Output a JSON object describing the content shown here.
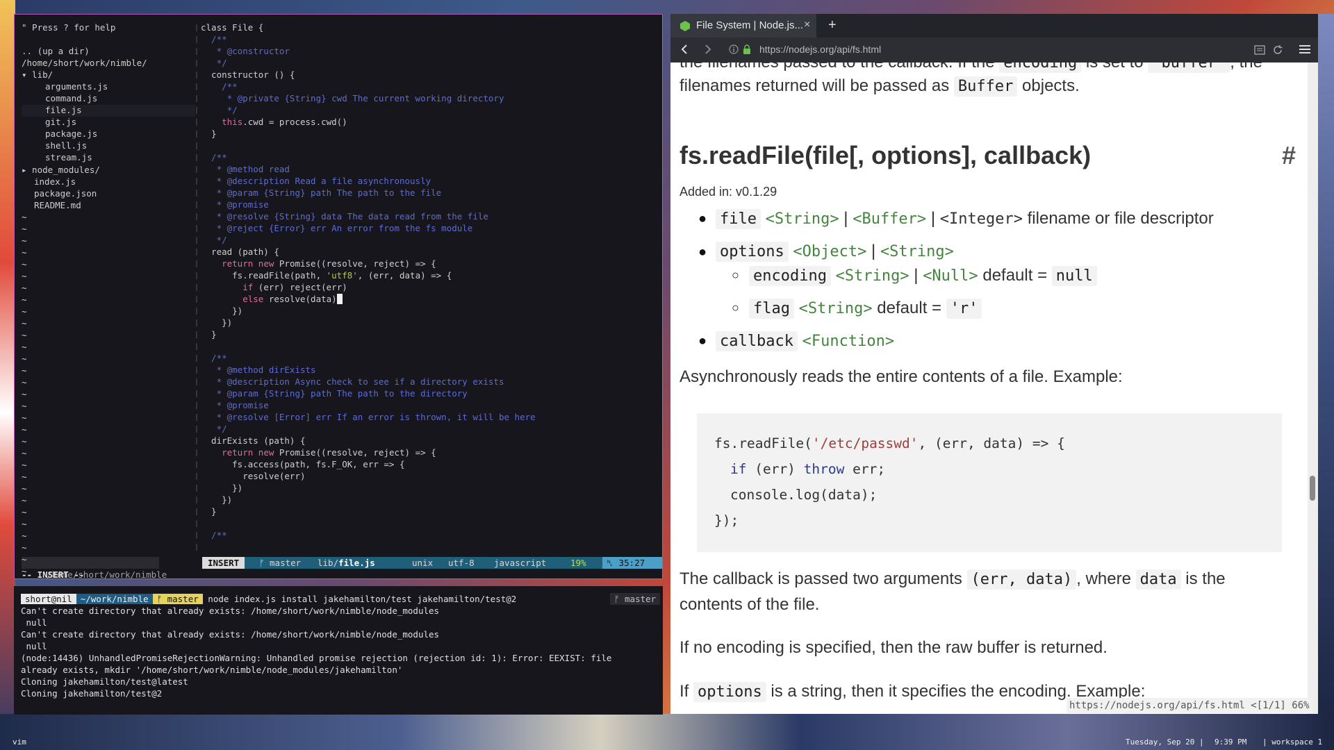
{
  "vim": {
    "tree": {
      "help": "\" Press ? for help",
      "up": ".. (up a dir)",
      "cwd": "/home/short/work/nimble/",
      "lib": "▾ lib/",
      "files_lib": [
        "arguments.js",
        "command.js",
        "file.js",
        "git.js",
        "package.js",
        "shell.js",
        "stream.js"
      ],
      "node_modules": "▸ node_modules/",
      "files_root": [
        "index.js",
        "package.json",
        "README.md"
      ],
      "tilde": "~"
    },
    "code_lines": [
      "class File {",
      "  /**",
      "   * @constructor",
      "   */",
      "  constructor () {",
      "    /**",
      "     * @private {String} cwd The current working directory",
      "     */",
      "    this.cwd = process.cwd()",
      "  }",
      "",
      "  /**",
      "   * @method read",
      "   * @description Read a file asynchronously",
      "   * @param {String} path The path to the file",
      "   * @promise",
      "   * @resolve {String} data The data read from the file",
      "   * @reject {Error} err An error from the fs module",
      "   */",
      "  read (path) {",
      "    return new Promise((resolve, reject) => {",
      "      fs.readFile(path, 'utf8', (err, data) => {",
      "        if (err) reject(err)",
      "        else resolve(data)",
      "      })",
      "    })",
      "  }",
      "",
      "  /**",
      "   * @method dirExists",
      "   * @description Async check to see if a directory exists",
      "   * @param {String} path The path to the directory",
      "   * @promise",
      "   * @resolve [Error] err If an error is thrown, it will be here",
      "   */",
      "  dirExists (path) {",
      "    return new Promise((resolve, reject) => {",
      "      fs.access(path, fs.F_OK, err => {",
      "        resolve(err)",
      "      })",
      "    })",
      "  }",
      "",
      "  /**"
    ],
    "status": {
      "tree_path": "/home/short/work/nimble",
      "mode": "INSERT",
      "branch": "ᚠ master",
      "file_dir": "lib/",
      "file_name": "file.js",
      "format": "unix",
      "encoding": "utf-8",
      "filetype": "javascript",
      "percent": "19%",
      "ln_icon": "␤",
      "position": "35:27"
    },
    "mode_line": "-- INSERT --"
  },
  "terminal": {
    "prompt_user": "short@nil",
    "prompt_path": "~/work/nimble",
    "prompt_branch": "ᚠ master",
    "command": "node index.js install jakehamilton/test jakehamilton/test@2",
    "right_branch": "ᚠ master",
    "lines": [
      "Can't create directory that already exists: /home/short/work/nimble/node_modules",
      " null",
      "Can't create directory that already exists: /home/short/work/nimble/node_modules",
      " null",
      "(node:14436) UnhandledPromiseRejectionWarning: Unhandled promise rejection (rejection id: 1): Error: EEXIST: file",
      "already exists, mkdir '/home/short/work/nimble/node_modules/jakehamilton'",
      "Cloning jakehamilton/test@latest",
      "Cloning jakehamilton/test@2"
    ]
  },
  "browser": {
    "tab_title": "File System | Node.js...",
    "tab_close": "×",
    "new_tab": "+",
    "url": "https://nodejs.org/api/fs.html",
    "top_partial_1": "the filenames passed to the callback. If the",
    "top_partial_code1": "encoding",
    "top_partial_2": "is set to",
    "top_partial_code2": "'buffer'",
    "top_partial_3": ", the",
    "filenames_1": "filenames returned will be passed as",
    "filenames_code": "Buffer",
    "filenames_2": "objects.",
    "heading": "fs.readFile(file[, options], callback)",
    "heading_anchor": "#",
    "added": "Added in: v0.1.29",
    "params": {
      "file": "file",
      "file_t1": "<String>",
      "file_sep1": "|",
      "file_t2": "<Buffer>",
      "file_sep2": "|",
      "file_t3": "<Integer>",
      "file_desc": "filename or file descriptor",
      "options": "options",
      "options_t1": "<Object>",
      "options_sep": "|",
      "options_t2": "<String>",
      "encoding": "encoding",
      "encoding_t1": "<String>",
      "encoding_sep": "|",
      "encoding_t2": "<Null>",
      "encoding_default": "default =",
      "encoding_default_val": "null",
      "flag": "flag",
      "flag_t": "<String>",
      "flag_default": "default =",
      "flag_default_val": "'r'",
      "callback": "callback",
      "callback_t": "<Function>"
    },
    "desc": "Asynchronously reads the entire contents of a file. Example:",
    "code": {
      "l1a": "fs.readFile(",
      "l1s": "'/etc/passwd'",
      "l1b": ", (err, data) => {",
      "l2k": "if",
      "l2a": " (err) ",
      "l2k2": "throw",
      "l2b": " err;",
      "l3": "console.log(data);",
      "l4": "});"
    },
    "cb_1": "The callback is passed two arguments",
    "cb_code1": "(err, data)",
    "cb_2": ", where",
    "cb_code2": "data",
    "cb_3": "is the",
    "cb_line2": "contents of the file.",
    "noenc": "If no encoding is specified, then the raw buffer is returned.",
    "opt_1": "If",
    "opt_code": "options",
    "opt_2": "is a string, then it specifies the encoding. Example:",
    "status_url": "https://nodejs.org/api/fs.html <[1/1] 66%"
  },
  "bottom": {
    "left": "vim",
    "date": "Tuesday, Sep 20 |",
    "time": "9:39 PM",
    "workspace": "| workspace 1"
  }
}
